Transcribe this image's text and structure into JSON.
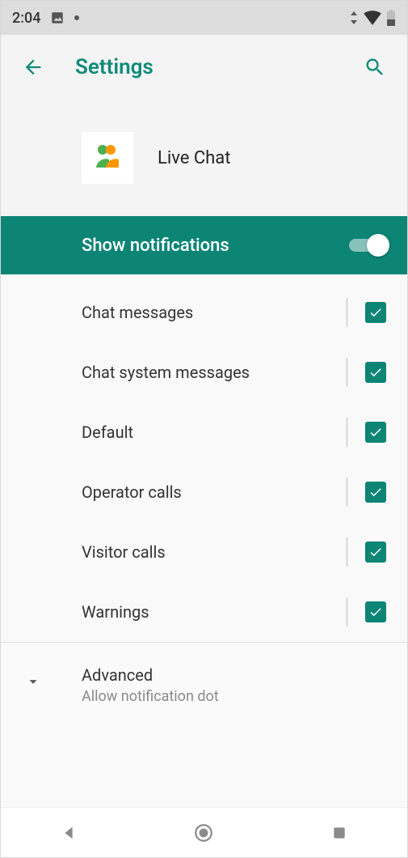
{
  "status": {
    "time": "2:04"
  },
  "header": {
    "title": "Settings"
  },
  "app": {
    "name": "Live Chat"
  },
  "notifications": {
    "toggle_label": "Show notifications",
    "enabled": true
  },
  "categories": [
    {
      "label": "Chat messages",
      "checked": true
    },
    {
      "label": "Chat system messages",
      "checked": true
    },
    {
      "label": "Default",
      "checked": true
    },
    {
      "label": "Operator calls",
      "checked": true
    },
    {
      "label": "Visitor calls",
      "checked": true
    },
    {
      "label": "Warnings",
      "checked": true
    }
  ],
  "advanced": {
    "title": "Advanced",
    "subtitle": "Allow notification dot"
  },
  "colors": {
    "accent": "#0c8575",
    "accent_text": "#0f8b78"
  }
}
